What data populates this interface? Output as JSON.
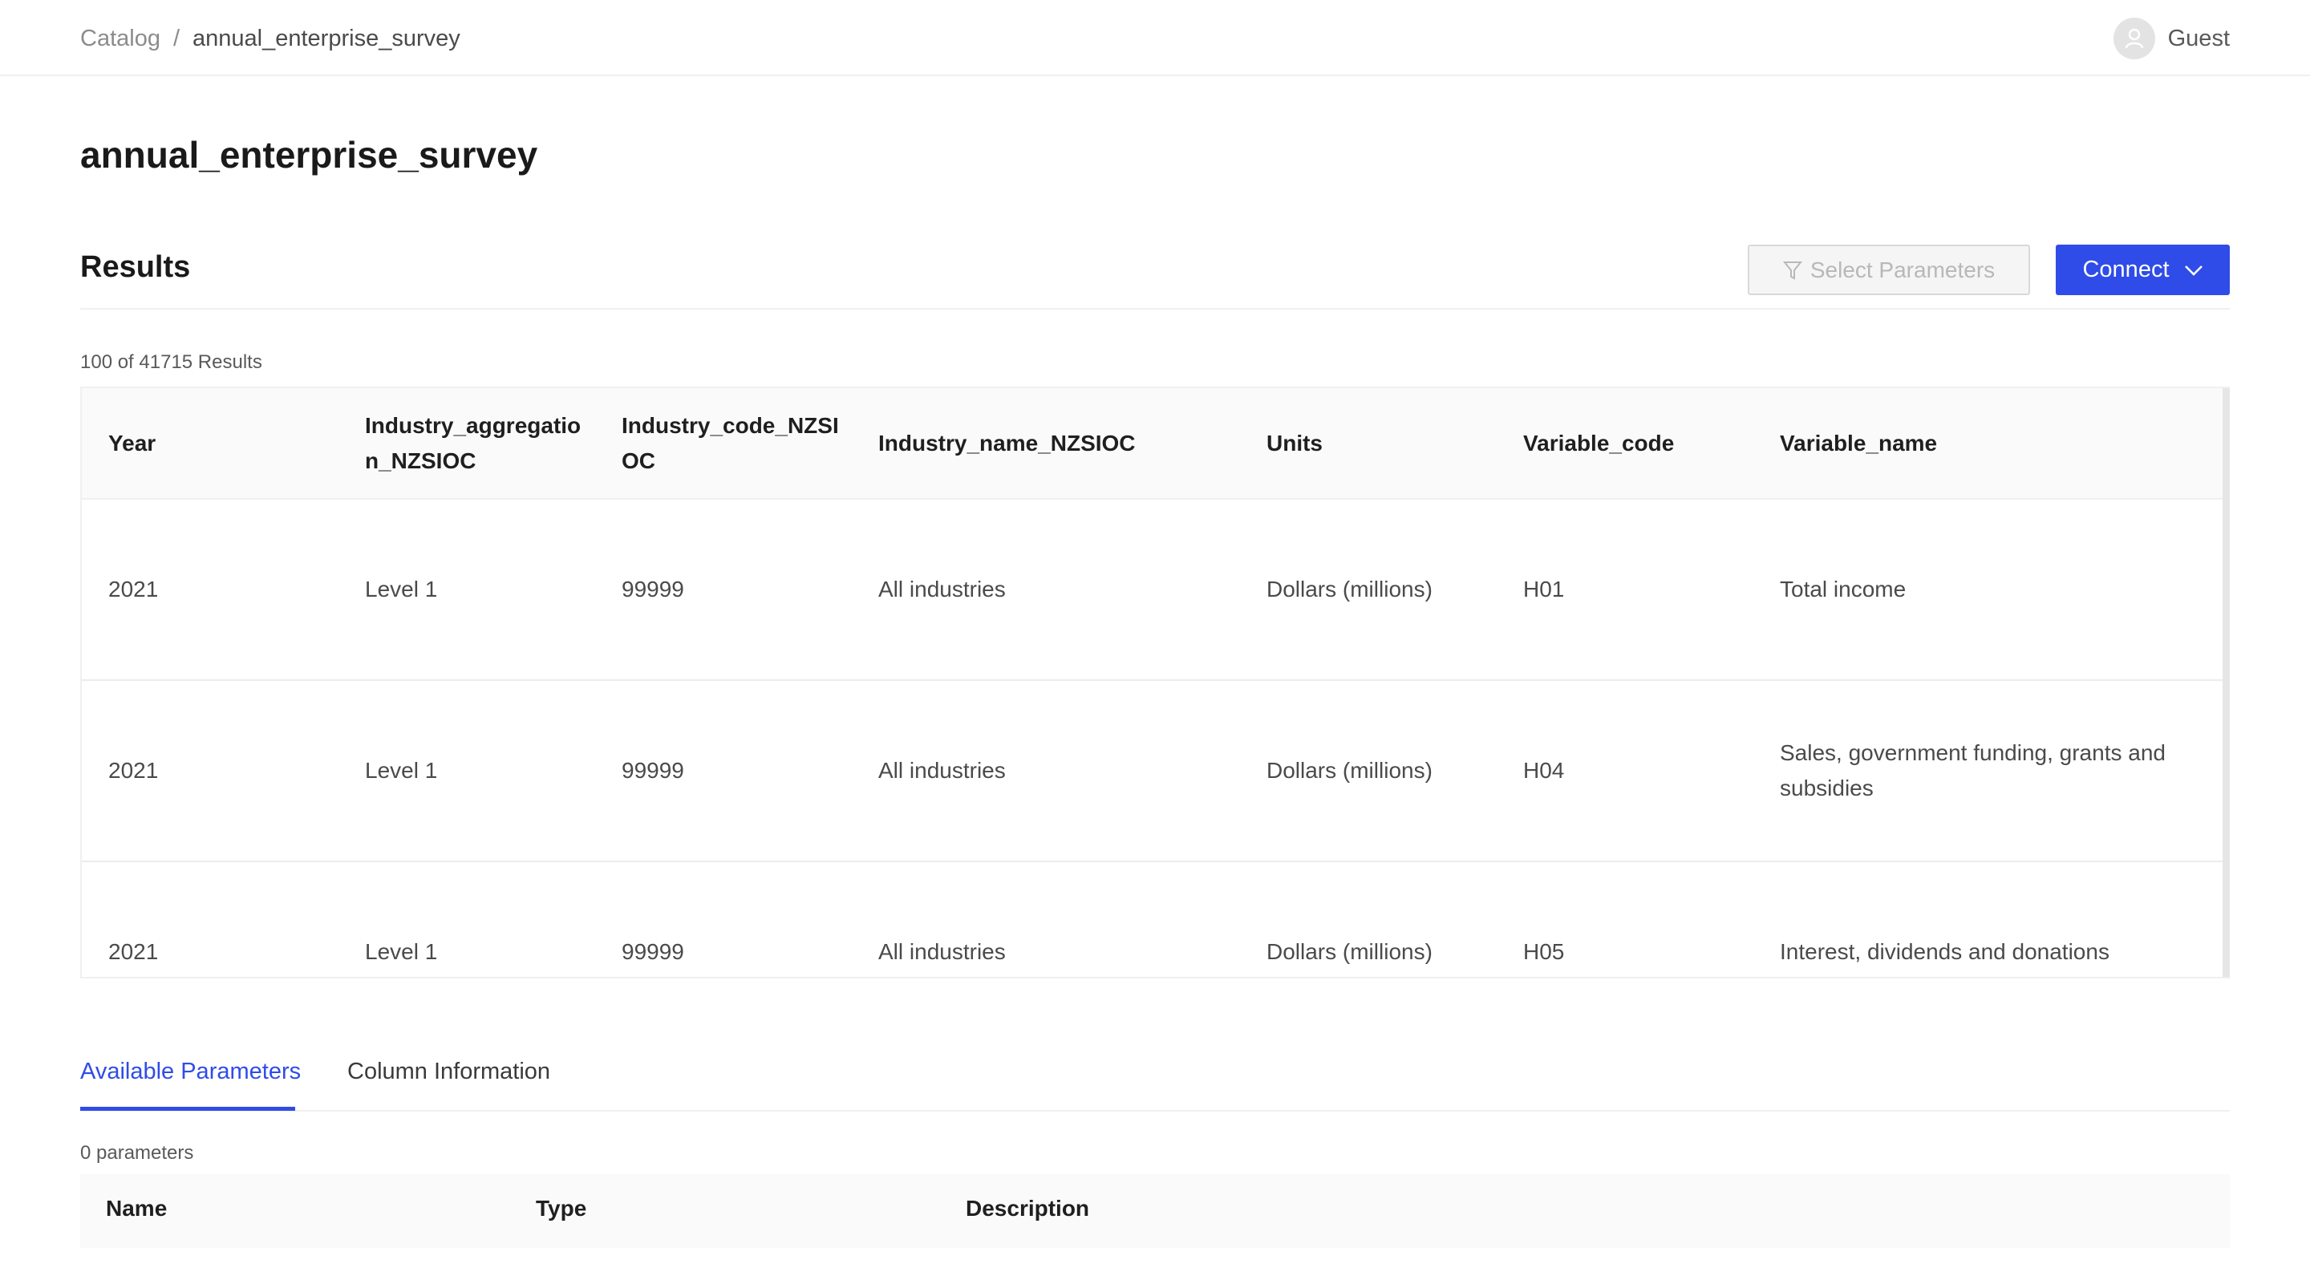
{
  "breadcrumb": {
    "root": "Catalog",
    "separator": "/",
    "current": "annual_enterprise_survey"
  },
  "user": {
    "name": "Guest",
    "icon": "user-icon"
  },
  "page": {
    "title": "annual_enterprise_survey"
  },
  "results": {
    "title": "Results",
    "select_params_label": "Select Parameters",
    "connect_label": "Connect",
    "count_text": "100 of 41715 Results"
  },
  "table": {
    "columns": [
      "Year",
      "Industry_aggregation_NZSIOC",
      "Industry_code_NZSIOC",
      "Industry_name_NZSIOC",
      "Units",
      "Variable_code",
      "Variable_name"
    ],
    "rows": [
      [
        "2021",
        "Level 1",
        "99999",
        "All industries",
        "Dollars (millions)",
        "H01",
        "Total income"
      ],
      [
        "2021",
        "Level 1",
        "99999",
        "All industries",
        "Dollars (millions)",
        "H04",
        "Sales, government funding, grants and subsidies"
      ],
      [
        "2021",
        "Level 1",
        "99999",
        "All industries",
        "Dollars (millions)",
        "H05",
        "Interest, dividends and donations"
      ]
    ]
  },
  "tabs": [
    {
      "label": "Available Parameters",
      "active": true
    },
    {
      "label": "Column Information",
      "active": false
    }
  ],
  "parameters": {
    "count_text": "0 parameters",
    "columns": [
      "Name",
      "Type",
      "Description"
    ]
  },
  "colors": {
    "accent": "#2f4ce8",
    "border": "#f0f0f0",
    "header_bg": "#fafafa"
  }
}
